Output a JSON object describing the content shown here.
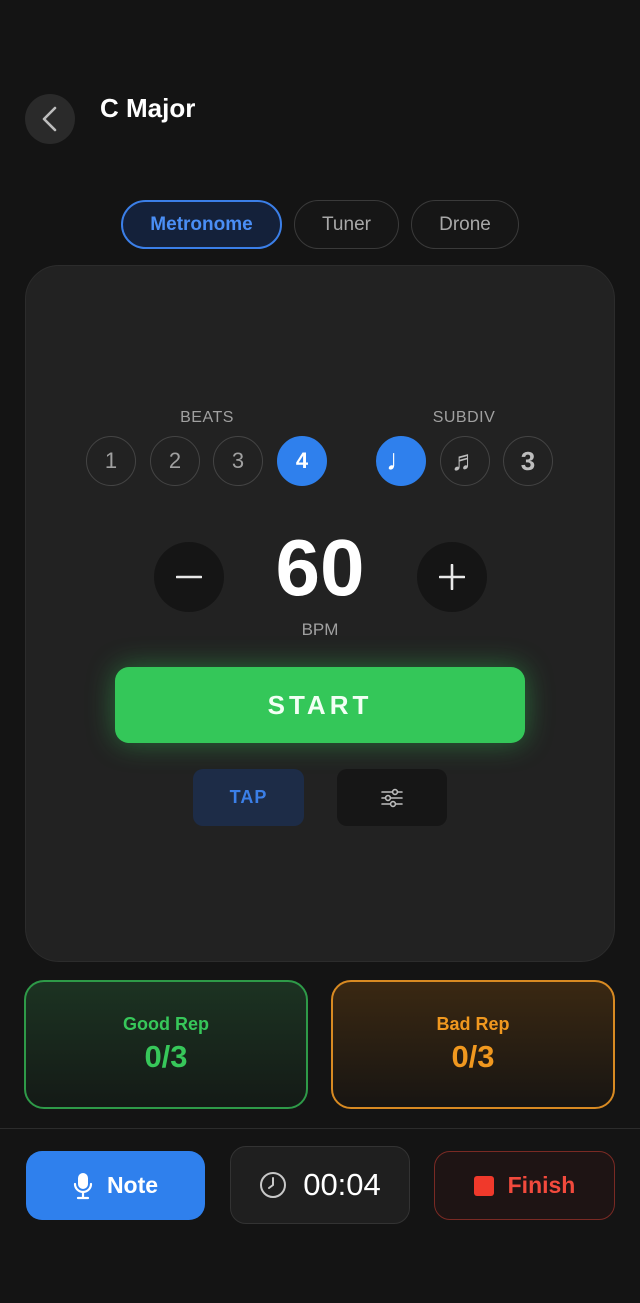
{
  "header": {
    "title": "C Major",
    "back_icon": "chevron-left-icon"
  },
  "tabs": [
    {
      "label": "Metronome",
      "active": true
    },
    {
      "label": "Tuner",
      "active": false
    },
    {
      "label": "Drone",
      "active": false
    }
  ],
  "metronome": {
    "beats_label": "BEATS",
    "beats": [
      "1",
      "2",
      "3",
      "4"
    ],
    "selected_beat": "4",
    "subdiv_label": "SUBDIV",
    "subdivisions": [
      {
        "icon": "quarter-note-icon",
        "symbol": "♩",
        "active": true
      },
      {
        "icon": "eighth-notes-icon",
        "symbol": "♬",
        "active": false
      },
      {
        "icon": "triplet-icon",
        "symbol": "3",
        "active": false
      }
    ],
    "bpm": "60",
    "bpm_label": "BPM",
    "start_label": "START",
    "tap_label": "TAP",
    "settings_icon": "sliders-icon"
  },
  "reps": {
    "good": {
      "label": "Good Rep",
      "value": "0/3"
    },
    "bad": {
      "label": "Bad Rep",
      "value": "0/3"
    }
  },
  "footer": {
    "note_label": "Note",
    "note_icon": "microphone-icon",
    "timer": "00:04",
    "timer_icon": "clock-icon",
    "finish_label": "Finish",
    "finish_icon": "stop-icon"
  },
  "colors": {
    "accent_blue": "#2f80ed",
    "start_green": "#34c759",
    "good_green": "#37c75a",
    "bad_orange": "#f0981f",
    "finish_red": "#f24a3d"
  }
}
